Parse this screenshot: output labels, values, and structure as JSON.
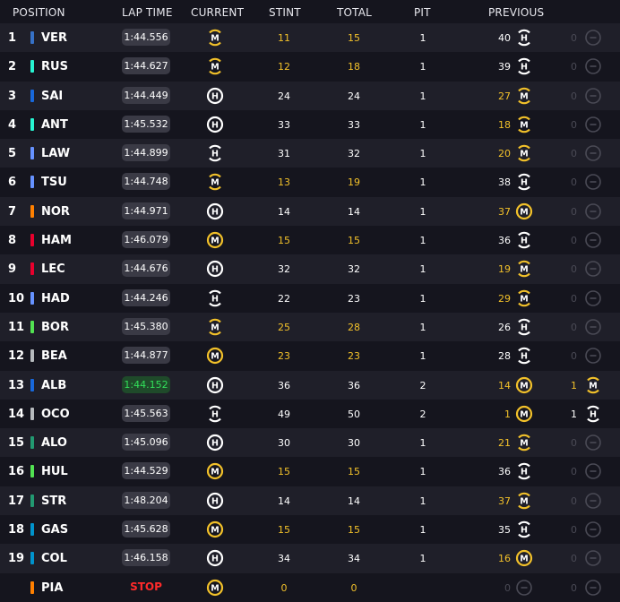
{
  "headers": {
    "position": "POSITION",
    "lap_time": "LAP TIME",
    "current": "CURRENT",
    "stint": "STINT",
    "total": "TOTAL",
    "pit": "PIT",
    "previous": "PREVIOUS"
  },
  "colors": {
    "medium": "#f2c12a",
    "hard": "#ffffff",
    "none": "#4a4a55",
    "best_lap": "#32e05a",
    "stop": "#ff2a2a"
  },
  "rows": [
    {
      "pos": "1",
      "driver": "VER",
      "team_color": "#3671c6",
      "lap": "1:44.556",
      "lap_state": "normal",
      "cur": "M",
      "cur_new": false,
      "stint": "11",
      "total": "15",
      "pit": "1",
      "prev_count": "40",
      "prev": "H",
      "prev_new": false,
      "prev2_count": "0",
      "prev2": "none"
    },
    {
      "pos": "2",
      "driver": "RUS",
      "team_color": "#27f4d2",
      "lap": "1:44.627",
      "lap_state": "normal",
      "cur": "M",
      "cur_new": false,
      "stint": "12",
      "total": "18",
      "pit": "1",
      "prev_count": "39",
      "prev": "H",
      "prev_new": false,
      "prev2_count": "0",
      "prev2": "none"
    },
    {
      "pos": "3",
      "driver": "SAI",
      "team_color": "#1868db",
      "lap": "1:44.449",
      "lap_state": "normal",
      "cur": "H",
      "cur_new": true,
      "stint": "24",
      "total": "24",
      "pit": "1",
      "prev_count": "27",
      "prev": "M",
      "prev_new": false,
      "prev2_count": "0",
      "prev2": "none"
    },
    {
      "pos": "4",
      "driver": "ANT",
      "team_color": "#27f4d2",
      "lap": "1:45.532",
      "lap_state": "normal",
      "cur": "H",
      "cur_new": true,
      "stint": "33",
      "total": "33",
      "pit": "1",
      "prev_count": "18",
      "prev": "M",
      "prev_new": false,
      "prev2_count": "0",
      "prev2": "none"
    },
    {
      "pos": "5",
      "driver": "LAW",
      "team_color": "#6692ff",
      "lap": "1:44.899",
      "lap_state": "normal",
      "cur": "H",
      "cur_new": false,
      "stint": "31",
      "total": "32",
      "pit": "1",
      "prev_count": "20",
      "prev": "M",
      "prev_new": false,
      "prev2_count": "0",
      "prev2": "none"
    },
    {
      "pos": "6",
      "driver": "TSU",
      "team_color": "#6692ff",
      "lap": "1:44.748",
      "lap_state": "normal",
      "cur": "M",
      "cur_new": false,
      "stint": "13",
      "total": "19",
      "pit": "1",
      "prev_count": "38",
      "prev": "H",
      "prev_new": false,
      "prev2_count": "0",
      "prev2": "none"
    },
    {
      "pos": "7",
      "driver": "NOR",
      "team_color": "#ff8000",
      "lap": "1:44.971",
      "lap_state": "normal",
      "cur": "H",
      "cur_new": true,
      "stint": "14",
      "total": "14",
      "pit": "1",
      "prev_count": "37",
      "prev": "M",
      "prev_new": true,
      "prev2_count": "0",
      "prev2": "none"
    },
    {
      "pos": "8",
      "driver": "HAM",
      "team_color": "#e8002d",
      "lap": "1:46.079",
      "lap_state": "normal",
      "cur": "M",
      "cur_new": true,
      "stint": "15",
      "total": "15",
      "pit": "1",
      "prev_count": "36",
      "prev": "H",
      "prev_new": false,
      "prev2_count": "0",
      "prev2": "none"
    },
    {
      "pos": "9",
      "driver": "LEC",
      "team_color": "#e8002d",
      "lap": "1:44.676",
      "lap_state": "normal",
      "cur": "H",
      "cur_new": true,
      "stint": "32",
      "total": "32",
      "pit": "1",
      "prev_count": "19",
      "prev": "M",
      "prev_new": false,
      "prev2_count": "0",
      "prev2": "none"
    },
    {
      "pos": "10",
      "driver": "HAD",
      "team_color": "#6692ff",
      "lap": "1:44.246",
      "lap_state": "normal",
      "cur": "H",
      "cur_new": false,
      "stint": "22",
      "total": "23",
      "pit": "1",
      "prev_count": "29",
      "prev": "M",
      "prev_new": false,
      "prev2_count": "0",
      "prev2": "none"
    },
    {
      "pos": "11",
      "driver": "BOR",
      "team_color": "#52e252",
      "lap": "1:45.380",
      "lap_state": "normal",
      "cur": "M",
      "cur_new": false,
      "stint": "25",
      "total": "28",
      "pit": "1",
      "prev_count": "26",
      "prev": "H",
      "prev_new": false,
      "prev2_count": "0",
      "prev2": "none"
    },
    {
      "pos": "12",
      "driver": "BEA",
      "team_color": "#b6babd",
      "lap": "1:44.877",
      "lap_state": "normal",
      "cur": "M",
      "cur_new": true,
      "stint": "23",
      "total": "23",
      "pit": "1",
      "prev_count": "28",
      "prev": "H",
      "prev_new": false,
      "prev2_count": "0",
      "prev2": "none"
    },
    {
      "pos": "13",
      "driver": "ALB",
      "team_color": "#1868db",
      "lap": "1:44.152",
      "lap_state": "best",
      "cur": "H",
      "cur_new": true,
      "stint": "36",
      "total": "36",
      "pit": "2",
      "prev_count": "14",
      "prev": "M",
      "prev_new": true,
      "prev2_count": "1",
      "prev2": "M"
    },
    {
      "pos": "14",
      "driver": "OCO",
      "team_color": "#b6babd",
      "lap": "1:45.563",
      "lap_state": "normal",
      "cur": "H",
      "cur_new": false,
      "stint": "49",
      "total": "50",
      "pit": "2",
      "prev_count": "1",
      "prev": "M",
      "prev_new": true,
      "prev2_count": "1",
      "prev2": "H"
    },
    {
      "pos": "15",
      "driver": "ALO",
      "team_color": "#229971",
      "lap": "1:45.096",
      "lap_state": "normal",
      "cur": "H",
      "cur_new": true,
      "stint": "30",
      "total": "30",
      "pit": "1",
      "prev_count": "21",
      "prev": "M",
      "prev_new": false,
      "prev2_count": "0",
      "prev2": "none"
    },
    {
      "pos": "16",
      "driver": "HUL",
      "team_color": "#52e252",
      "lap": "1:44.529",
      "lap_state": "normal",
      "cur": "M",
      "cur_new": true,
      "stint": "15",
      "total": "15",
      "pit": "1",
      "prev_count": "36",
      "prev": "H",
      "prev_new": false,
      "prev2_count": "0",
      "prev2": "none"
    },
    {
      "pos": "17",
      "driver": "STR",
      "team_color": "#229971",
      "lap": "1:48.204",
      "lap_state": "normal",
      "cur": "H",
      "cur_new": true,
      "stint": "14",
      "total": "14",
      "pit": "1",
      "prev_count": "37",
      "prev": "M",
      "prev_new": false,
      "prev2_count": "0",
      "prev2": "none"
    },
    {
      "pos": "18",
      "driver": "GAS",
      "team_color": "#0093cc",
      "lap": "1:45.628",
      "lap_state": "normal",
      "cur": "M",
      "cur_new": true,
      "stint": "15",
      "total": "15",
      "pit": "1",
      "prev_count": "35",
      "prev": "H",
      "prev_new": false,
      "prev2_count": "0",
      "prev2": "none"
    },
    {
      "pos": "19",
      "driver": "COL",
      "team_color": "#0093cc",
      "lap": "1:46.158",
      "lap_state": "normal",
      "cur": "H",
      "cur_new": true,
      "stint": "34",
      "total": "34",
      "pit": "1",
      "prev_count": "16",
      "prev": "M",
      "prev_new": true,
      "prev2_count": "0",
      "prev2": "none"
    },
    {
      "pos": "",
      "driver": "PIA",
      "team_color": "#ff8000",
      "lap": "STOP",
      "lap_state": "stop",
      "cur": "M",
      "cur_new": true,
      "stint": "0",
      "total": "0",
      "pit": "",
      "prev_count": "0",
      "prev": "none",
      "prev_new": false,
      "prev2_count": "0",
      "prev2": "none"
    }
  ]
}
